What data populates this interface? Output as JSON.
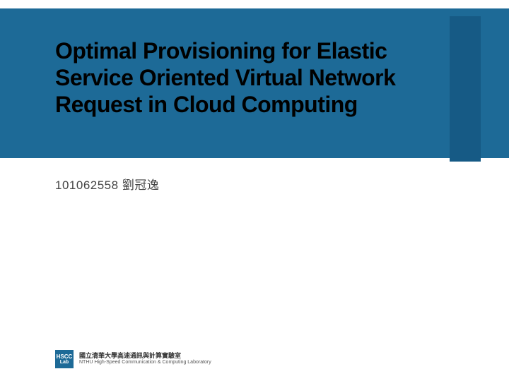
{
  "slide": {
    "title": "Optimal Provisioning for Elastic Service Oriented Virtual Network Request in Cloud Computing",
    "author_id": "101062558",
    "author_name": "劉冠逸"
  },
  "footer": {
    "logo_text_1": "HSCC",
    "logo_text_2": "Lab",
    "lab_name_zh": "國立清華大學高速通訊與計算實驗室",
    "lab_name_en": "NTHU High-Speed Communication & Computing Laboratory"
  },
  "colors": {
    "banner": "#1d6a97",
    "accent": "#165a85"
  }
}
